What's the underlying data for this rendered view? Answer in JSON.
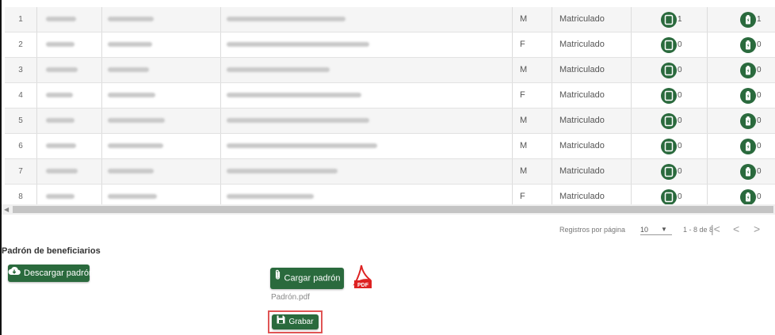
{
  "table": {
    "rows": [
      {
        "num": "1",
        "sex": "M",
        "status": "Matriculado",
        "count1": "1",
        "count2": "1"
      },
      {
        "num": "2",
        "sex": "F",
        "status": "Matriculado",
        "count1": "0",
        "count2": "0"
      },
      {
        "num": "3",
        "sex": "M",
        "status": "Matriculado",
        "count1": "0",
        "count2": "0"
      },
      {
        "num": "4",
        "sex": "F",
        "status": "Matriculado",
        "count1": "0",
        "count2": "0"
      },
      {
        "num": "5",
        "sex": "M",
        "status": "Matriculado",
        "count1": "0",
        "count2": "0"
      },
      {
        "num": "6",
        "sex": "M",
        "status": "Matriculado",
        "count1": "0",
        "count2": "0"
      },
      {
        "num": "7",
        "sex": "M",
        "status": "Matriculado",
        "count1": "0",
        "count2": "0"
      },
      {
        "num": "8",
        "sex": "F",
        "status": "Matriculado",
        "count1": "0",
        "count2": "0"
      }
    ],
    "device_icon_1": "tablet-icon",
    "device_icon_2": "battery-icon",
    "icon_color": "#2a6a3d"
  },
  "pagination": {
    "per_page_label": "Registros por página",
    "per_page_value": "10",
    "range": "1 - 8 de 8",
    "first": "|<",
    "prev": "<",
    "next": ">"
  },
  "beneficiaries": {
    "title": "Padrón de beneficiarios",
    "download_label": "Descargar padrón",
    "upload_label": "Cargar padrón",
    "file_name": "Padrón.pdf",
    "save_label": "Grabar",
    "pdf_badge": "PDF"
  },
  "colors": {
    "primary": "#2a6a3d",
    "highlight_border": "#e05555"
  }
}
